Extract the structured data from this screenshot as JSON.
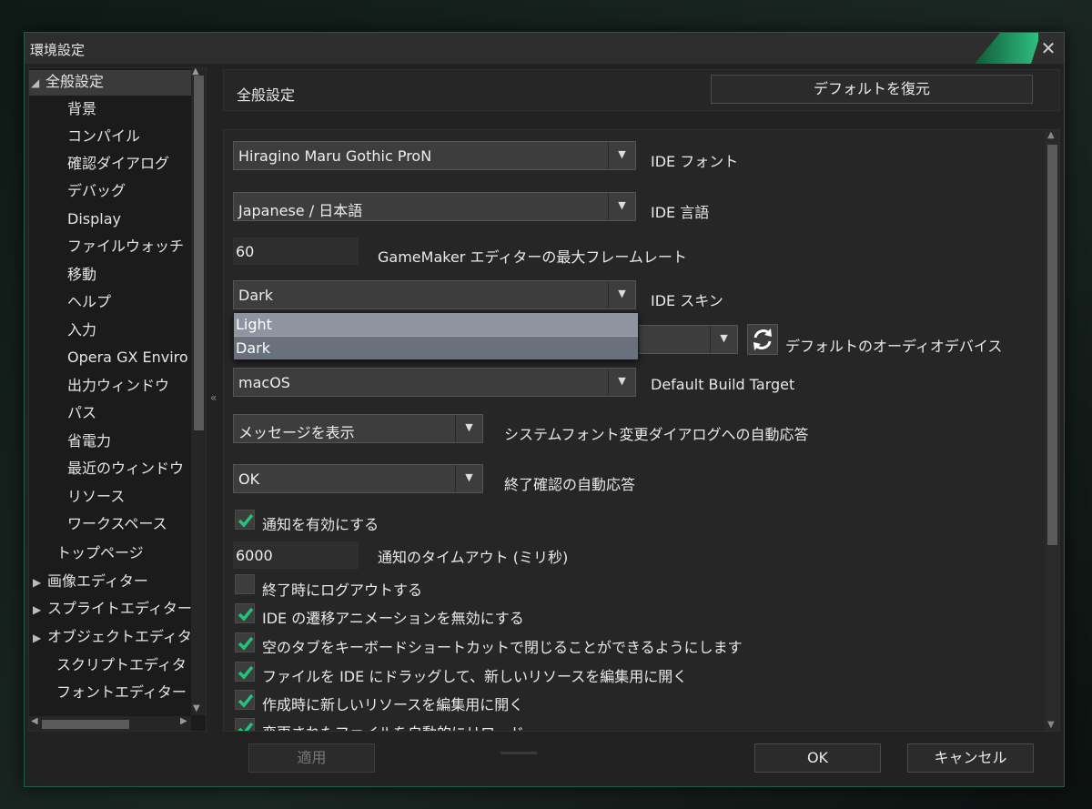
{
  "window": {
    "title": "環境設定",
    "close_glyph": "✕"
  },
  "sidebar": {
    "items": [
      {
        "label": "全般設定",
        "arrow": "◢"
      },
      {
        "label": "背景"
      },
      {
        "label": "コンパイル"
      },
      {
        "label": "確認ダイアログ"
      },
      {
        "label": "デバッグ"
      },
      {
        "label": "Display"
      },
      {
        "label": "ファイルウォッチ"
      },
      {
        "label": "移動"
      },
      {
        "label": "ヘルプ"
      },
      {
        "label": "入力"
      },
      {
        "label": "Opera GX Enviro"
      },
      {
        "label": "出力ウィンドウ"
      },
      {
        "label": "パス"
      },
      {
        "label": "省電力"
      },
      {
        "label": "最近のウィンドウ"
      },
      {
        "label": "リソース"
      },
      {
        "label": "ワークスペース"
      },
      {
        "label": "トップページ"
      },
      {
        "label": "画像エディター",
        "arrow": "▶"
      },
      {
        "label": "スプライトエディター",
        "arrow": "▶"
      },
      {
        "label": "オブジェクトエディタ",
        "arrow": "▶"
      },
      {
        "label": "スクリプトエディタ"
      },
      {
        "label": "フォントエディター"
      }
    ],
    "collapse_glyph": "«"
  },
  "header": {
    "title": "全般設定",
    "restore_defaults": "デフォルトを復元"
  },
  "settings": {
    "ide_font": {
      "value": "Hiragino Maru Gothic ProN",
      "label": "IDE フォント"
    },
    "ide_language": {
      "value": "Japanese / 日本語",
      "label": "IDE 言語"
    },
    "max_framerate": {
      "value": "60",
      "label": "GameMaker エディターの最大フレームレート"
    },
    "ide_skin": {
      "value": "Dark",
      "label": "IDE スキン",
      "options": [
        "Light",
        "Dark"
      ]
    },
    "audio_device": {
      "value": "",
      "label": "デフォルトのオーディオデバイス"
    },
    "build_target": {
      "value": "macOS",
      "label": "Default Build Target"
    },
    "system_font_dialog": {
      "value": "メッセージを表示",
      "label": "システムフォント変更ダイアログへの自動応答"
    },
    "exit_confirm": {
      "value": "OK",
      "label": "終了確認の自動応答"
    },
    "enable_notifications": {
      "label": "通知を有効にする",
      "checked": true
    },
    "notification_timeout": {
      "value": "6000",
      "label": "通知のタイムアウト (ミリ秒)"
    },
    "logout_on_exit": {
      "label": "終了時にログアウトする",
      "checked": false
    },
    "disable_transitions": {
      "label": "IDE の遷移アニメーションを無効にする",
      "checked": true
    },
    "close_empty_tabs": {
      "label": "空のタブをキーボードショートカットで閉じることができるようにします",
      "checked": true
    },
    "drag_open_edit": {
      "label": "ファイルを IDE にドラッグして、新しいリソースを編集用に開く",
      "checked": true
    },
    "open_new_for_edit": {
      "label": "作成時に新しいリソースを編集用に開く",
      "checked": true
    },
    "auto_reload": {
      "label": "変更されたファイルを自動的にリロード",
      "checked": true
    }
  },
  "footer": {
    "apply": "適用",
    "ok": "OK",
    "cancel": "キャンセル"
  },
  "colors": {
    "accent": "#2fbf7f",
    "check": "#22c37a",
    "window_bg": "#222222"
  }
}
